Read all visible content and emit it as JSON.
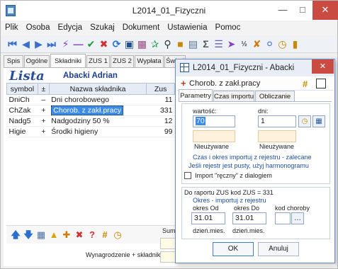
{
  "window": {
    "title": "L2014_01_Fizyczni"
  },
  "menu": [
    "Plik",
    "Osoba",
    "Edycja",
    "Szukaj",
    "Dokument",
    "Ustawienia",
    "Pomoc"
  ],
  "tabs": [
    "Spis",
    "Ogólne",
    "Składniki",
    "ZUS 1",
    "ZUS 2",
    "Wypłata",
    "Świad"
  ],
  "panel": {
    "heading": "Lista",
    "person": "Abacki Adrian"
  },
  "grid": {
    "columns": [
      "symbol",
      "±",
      "Nazwa składnika",
      "Zus"
    ],
    "rows": [
      {
        "symbol": "DniCh",
        "sign": "–",
        "name": "Dni chorobowego",
        "zus": "11"
      },
      {
        "symbol": "ChZak",
        "sign": "+",
        "name": "Chorob. z zakł.pracy",
        "zus": "331"
      },
      {
        "symbol": "Nadg5",
        "sign": "+",
        "name": "Nadgodziny 50 %",
        "zus": "12"
      },
      {
        "symbol": "Higie",
        "sign": "+",
        "name": "Środki higieny",
        "zus": "99"
      }
    ]
  },
  "footer": {
    "suma": "Suma",
    "wyn": "Wynagrodzenie + składniki"
  },
  "dialog": {
    "title": "L2014_01_Fizyczni  -  Abacki",
    "item": "Chorob. z zakł.pracy",
    "tabs": [
      "Parametry",
      "Czas importu",
      "Obliczanie"
    ],
    "wartosc_label": "wartość:",
    "wartosc_value": "70",
    "dni_label": "dni:",
    "dni_value": "1",
    "nieuzywane1": "Nieużywane",
    "nieuzywane2": "Nieużywane",
    "info1": "Czas i okres importuj z rejestru - zalecane",
    "info2": "Jeśli rejestr jest pusty, użyj  harmonogramu",
    "checkbox_label": "Import \"ręczny\" z dialogiem",
    "zus_line": "Do raportu ZUS    kod ZUS = 331",
    "okres_info": "Okres - importuj z rejestru",
    "okres_od_label": "okres  Od",
    "okres_do_label": "okres  Do",
    "kod_choroby_label": "kod choroby",
    "okres_od": "31.01",
    "okres_do": "31.01",
    "dzien1": "dzień.mies.",
    "dzien2": "dzień.mies.",
    "ok": "OK",
    "cancel": "Anuluj"
  }
}
